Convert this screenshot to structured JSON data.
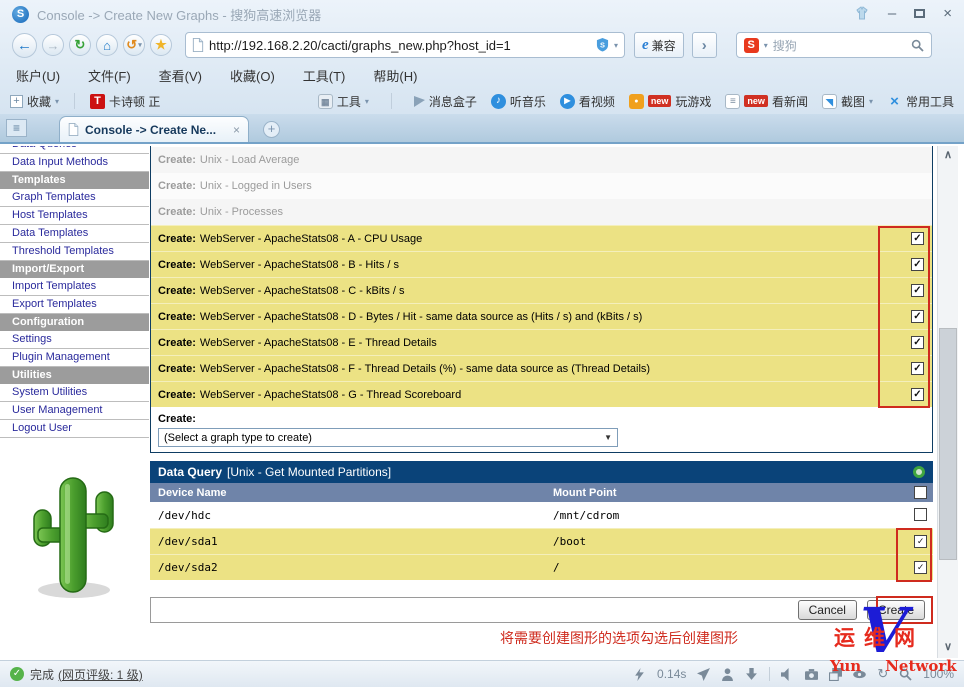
{
  "window": {
    "title": "Console -> Create New Graphs - 搜狗高速浏览器"
  },
  "address_bar": {
    "url": "http://192.168.2.20/cacti/graphs_new.php?host_id=1",
    "compat_label": "兼容",
    "search_engine": "搜狗"
  },
  "menu_bar": {
    "items": [
      "账户(U)",
      "文件(F)",
      "查看(V)",
      "收藏(O)",
      "工具(T)",
      "帮助(H)"
    ]
  },
  "favorites_bar": {
    "add_label": "收藏",
    "bookmark_icon_letter": "T",
    "bookmark_label": "卡诗顿 正",
    "tools_label": "工具",
    "new_badge": "new",
    "right_items": [
      {
        "icon": "message-icon",
        "label": "消息盒子"
      },
      {
        "icon": "music-icon",
        "label": "听音乐"
      },
      {
        "icon": "video-icon",
        "label": "看视频"
      },
      {
        "icon": "game-icon",
        "label": "玩游戏",
        "new": true
      },
      {
        "icon": "news-icon",
        "label": "看新闻",
        "new": true
      },
      {
        "icon": "screenshot-icon",
        "label": "截图",
        "caret": true
      },
      {
        "icon": "tools-x-icon",
        "label": "常用工具"
      }
    ]
  },
  "tab_bar": {
    "active_tab": "Console -> Create Ne...",
    "close_glyph": "×"
  },
  "sidebar": {
    "items": [
      {
        "label": "Data Queries",
        "type": "item"
      },
      {
        "label": "Data Input Methods",
        "type": "item"
      },
      {
        "label": "Templates",
        "type": "header"
      },
      {
        "label": "Graph Templates",
        "type": "item"
      },
      {
        "label": "Host Templates",
        "type": "item"
      },
      {
        "label": "Data Templates",
        "type": "item"
      },
      {
        "label": "Threshold Templates",
        "type": "item"
      },
      {
        "label": "Import/Export",
        "type": "header"
      },
      {
        "label": "Import Templates",
        "type": "item"
      },
      {
        "label": "Export Templates",
        "type": "item"
      },
      {
        "label": "Configuration",
        "type": "header"
      },
      {
        "label": "Settings",
        "type": "item"
      },
      {
        "label": "Plugin Management",
        "type": "item"
      },
      {
        "label": "Utilities",
        "type": "header"
      },
      {
        "label": "System Utilities",
        "type": "item"
      },
      {
        "label": "User Management",
        "type": "item"
      },
      {
        "label": "Logout User",
        "type": "item"
      }
    ]
  },
  "content": {
    "create_label": "Create:",
    "graph_type_select": "(Select a graph type to create)",
    "create_rows": [
      {
        "prefix": "Create:",
        "label": "Unix - Load Average",
        "state": "muted",
        "checkbox": null
      },
      {
        "prefix": "Create:",
        "label": "Unix - Logged in Users",
        "state": "muted",
        "checkbox": null
      },
      {
        "prefix": "Create:",
        "label": "Unix - Processes",
        "state": "muted",
        "checkbox": null
      },
      {
        "prefix": "Create:",
        "label": "WebServer - ApacheStats08 - A - CPU Usage",
        "state": "selected",
        "checkbox": true
      },
      {
        "prefix": "Create:",
        "label": "WebServer - ApacheStats08 - B - Hits / s",
        "state": "selected",
        "checkbox": true
      },
      {
        "prefix": "Create:",
        "label": "WebServer - ApacheStats08 - C - kBits / s",
        "state": "selected",
        "checkbox": true
      },
      {
        "prefix": "Create:",
        "label": "WebServer - ApacheStats08 - D - Bytes / Hit - same data source as (Hits / s) and (kBits / s)",
        "state": "selected",
        "checkbox": true
      },
      {
        "prefix": "Create:",
        "label": "WebServer - ApacheStats08 - E - Thread Details",
        "state": "selected",
        "checkbox": true
      },
      {
        "prefix": "Create:",
        "label": "WebServer - ApacheStats08 - F - Thread Details (%) - same data source as (Thread Details)",
        "state": "selected",
        "checkbox": true
      },
      {
        "prefix": "Create:",
        "label": "WebServer - ApacheStats08 - G - Thread Scoreboard",
        "state": "selected",
        "checkbox": true
      }
    ],
    "data_query": {
      "title": "Data Query",
      "subtitle": "[Unix - Get Mounted Partitions]",
      "columns": [
        "Device Name",
        "Mount Point"
      ],
      "rows": [
        {
          "device": "/dev/hdc",
          "mount": "/mnt/cdrom",
          "checked": false
        },
        {
          "device": "/dev/sda1",
          "mount": "/boot",
          "checked": true
        },
        {
          "device": "/dev/sda2",
          "mount": "/",
          "checked": true
        }
      ]
    },
    "buttons": {
      "cancel": "Cancel",
      "create": "Create"
    },
    "annotation": "将需要创建图形的选项勾选后创建图形",
    "watermark": {
      "cn": "运维网",
      "v": "V",
      "en_left": "Yun",
      "en_right": "Network"
    }
  },
  "status_bar": {
    "status": "完成",
    "rating": "(网页评级: 1 级)",
    "load_time": "0.14s",
    "zoom": "100%"
  },
  "colors": {
    "dq_header_navy": "#0a4379",
    "dq_col_blue": "#6f84a9",
    "selected_yellow": "#ece284",
    "annotation_red": "#cf2b1e",
    "sidebar_header_gray": "#9c9c9c",
    "watermark_red": "#e62b1e",
    "watermark_blue": "#1c1cd6"
  }
}
